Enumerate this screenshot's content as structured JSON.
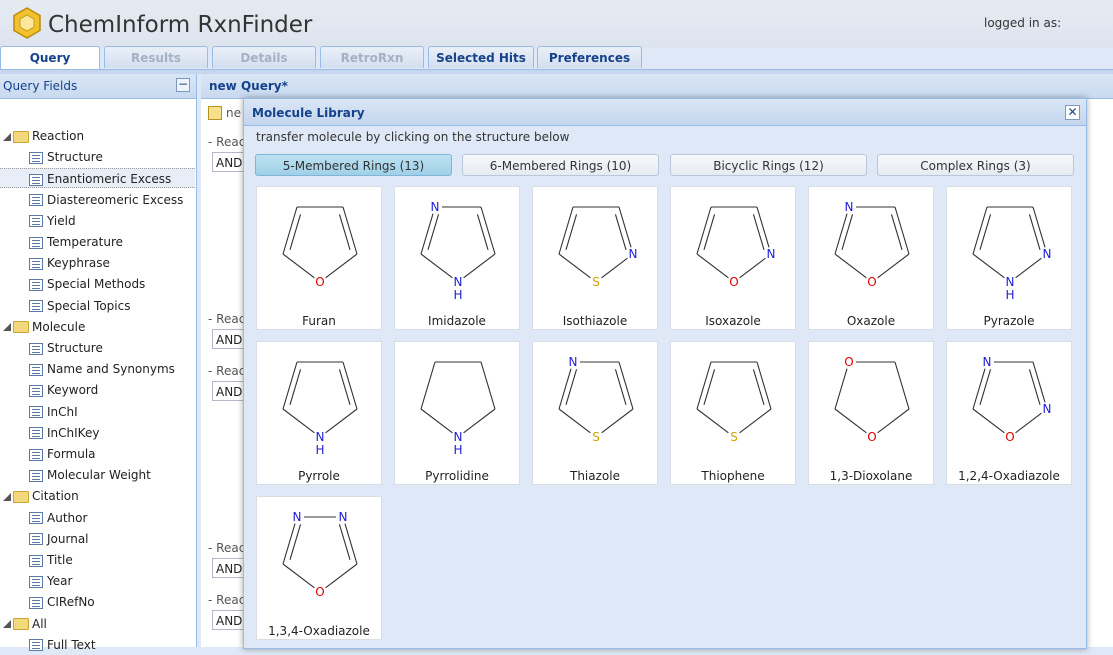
{
  "app": {
    "title": "ChemInform RxnFinder",
    "logged_in": "logged in as:"
  },
  "tabs": [
    "Query",
    "Results",
    "Details",
    "RetroRxn",
    "Selected Hits",
    "Preferences"
  ],
  "left_panel": {
    "title": "Query Fields",
    "collapse_symbol": "−",
    "groups": [
      {
        "label": "Reaction",
        "items": [
          "Structure",
          "Enantiomeric Excess",
          "Diastereomeric Excess",
          "Yield",
          "Temperature",
          "Keyphrase",
          "Special Methods",
          "Special Topics"
        ]
      },
      {
        "label": "Molecule",
        "items": [
          "Structure",
          "Name and Synonyms",
          "Keyword",
          "InChI",
          "InChIKey",
          "Formula",
          "Molecular Weight"
        ]
      },
      {
        "label": "Citation",
        "items": [
          "Author",
          "Journal",
          "Title",
          "Year",
          "CIRefNo"
        ]
      },
      {
        "label": "All",
        "items": [
          "Full Text"
        ]
      }
    ]
  },
  "main": {
    "title": "new Query*",
    "tab_fragment": "ne",
    "react_label": "React",
    "and_label": "AND"
  },
  "modal": {
    "title": "Molecule Library",
    "close_symbol": "✕",
    "hint": "transfer molecule by clicking on the structure below",
    "ring_tabs": [
      "5-Membered Rings (13)",
      "6-Membered Rings (10)",
      "Bicyclic Rings (12)",
      "Complex Rings (3)"
    ],
    "molecules": [
      "Furan",
      "Imidazole",
      "Isothiazole",
      "Isoxazole",
      "Oxazole",
      "Pyrazole",
      "Pyrrole",
      "Pyrrolidine",
      "Thiazole",
      "Thiophene",
      "1,3-Dioxolane",
      "1,2,4-Oxadiazole",
      "1,3,4-Oxadiazole"
    ],
    "atom_labels": {
      "O": "O",
      "N": "N",
      "S": "S",
      "H": "H"
    }
  },
  "colors": {
    "accent": "#15428b",
    "oxygen": "#e00000",
    "nitrogen": "#1d1dd8",
    "sulfur": "#d4a100",
    "bond": "#333333"
  }
}
